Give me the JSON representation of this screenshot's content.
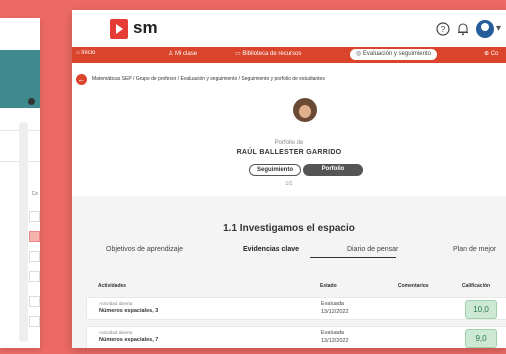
{
  "header": {
    "logo_text": "sm",
    "help_icon": "question-circle-icon",
    "bell_icon": "bell-icon",
    "avatar_icon": "user-avatar-icon",
    "chevron": "▾"
  },
  "nav": {
    "items": [
      {
        "label": "⌂ Inicio"
      },
      {
        "label": "♙ Mi clase"
      },
      {
        "label": "▭ Biblioteca de recursos"
      },
      {
        "label": "◎ Evaluación y seguimiento"
      },
      {
        "label": "⊕ Co"
      }
    ],
    "active_index": 3
  },
  "breadcrumb": {
    "text": "Matemáticas SEP  /  Grupo de profesor  /  Evaluación y seguimiento  /  Seguimiento y porfolio de estudiantes"
  },
  "profile": {
    "porfolio_de": "Porfolio de",
    "student_name": "RAÚL BALLESTER GARRIDO",
    "toggle": {
      "seguimiento": "Seguimiento",
      "porfolio": "Porfolio",
      "active": "Porfolio"
    },
    "page_count": "1/1"
  },
  "section": {
    "title": "1.1 Investigamos el espacio",
    "tabs": [
      {
        "label": "Objetivos de aprendizaje",
        "active": false
      },
      {
        "label": "Evidencias clave",
        "active": true
      },
      {
        "label": "Diario de pensar",
        "active": false
      },
      {
        "label": "Plan de mejor",
        "active": false
      }
    ]
  },
  "table": {
    "headers": {
      "actividades": "Actividades",
      "estado": "Estado",
      "comentarios": "Comentarios",
      "calificacion": "Calificación"
    },
    "rows": [
      {
        "status": "Actividad abierta",
        "title": "Números espaciales, 3",
        "estado": "Evaluada",
        "date": "13/12/2022",
        "grade": "10,0"
      },
      {
        "status": "Actividad abierta",
        "title": "Números espaciales, 7",
        "estado": "Evaluada",
        "date": "13/12/2022",
        "grade": "9,0"
      }
    ]
  },
  "background_window": {
    "label": "Ce"
  },
  "colors": {
    "brand_red": "#e53d36",
    "nav_red": "#d9442b",
    "background": "#ed6a64",
    "grade_green": "#cde8d4",
    "teal": "#3f8a8f"
  }
}
